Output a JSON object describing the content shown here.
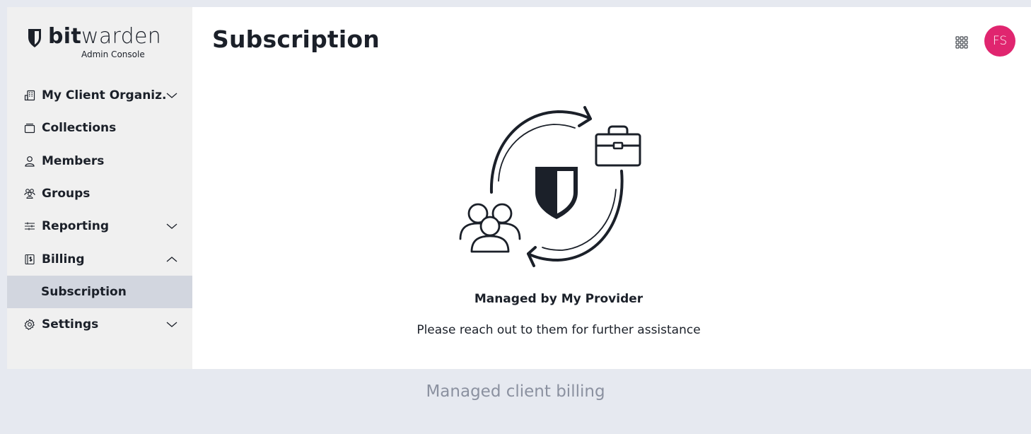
{
  "brand": {
    "name_bold": "bit",
    "name_light": "warden",
    "subtitle": "Admin Console"
  },
  "sidebar": {
    "items": [
      {
        "label": "My Client Organiz...",
        "icon": "organization-icon",
        "chevron": "down"
      },
      {
        "label": "Collections",
        "icon": "collections-icon"
      },
      {
        "label": "Members",
        "icon": "members-icon"
      },
      {
        "label": "Groups",
        "icon": "groups-icon"
      },
      {
        "label": "Reporting",
        "icon": "reporting-icon",
        "chevron": "down"
      },
      {
        "label": "Billing",
        "icon": "billing-icon",
        "chevron": "up"
      },
      {
        "label": "Subscription",
        "active": true
      },
      {
        "label": "Settings",
        "icon": "settings-icon",
        "chevron": "down"
      }
    ]
  },
  "header": {
    "title": "Subscription",
    "avatar_initials": "FS",
    "avatar_color": "#e0256f"
  },
  "message": {
    "title": "Managed by My Provider",
    "body": "Please reach out to them for further assistance"
  },
  "caption": "Managed client billing"
}
